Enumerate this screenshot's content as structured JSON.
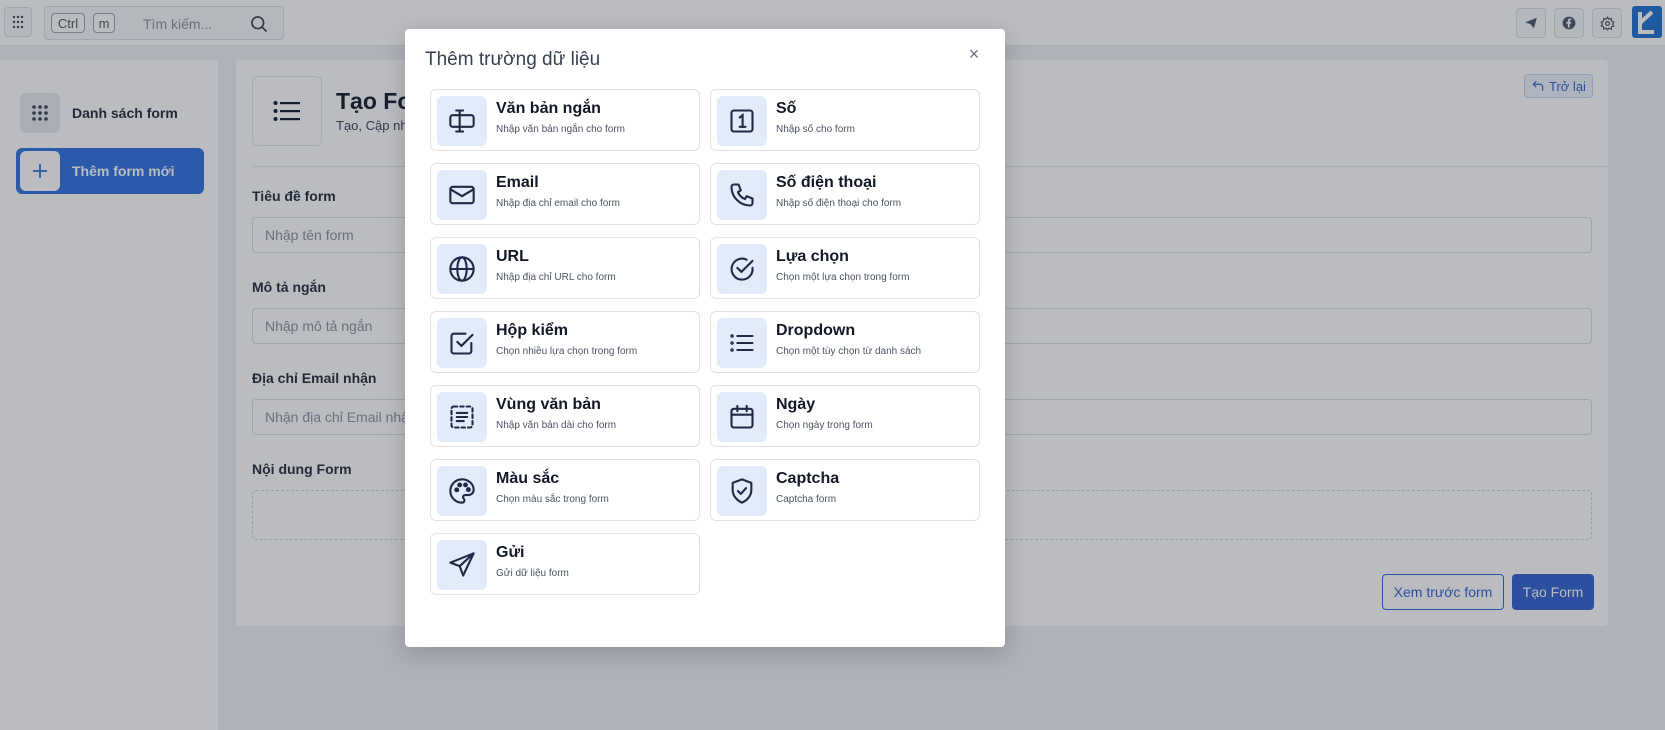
{
  "topbar": {
    "kbd_ctrl": "Ctrl",
    "kbd_m": "m",
    "search_placeholder": "Tìm kiếm..."
  },
  "sidebar": {
    "items": [
      {
        "label": "Danh sách form",
        "icon": "grid-icon"
      },
      {
        "label": "Thêm form mới",
        "icon": "plus-icon"
      }
    ]
  },
  "page": {
    "title": "Tạo Fo",
    "subtitle": "Tạo, Cập nh",
    "back_label": "Trở lại",
    "fields": [
      {
        "label": "Tiêu đề form",
        "placeholder": "Nhập tên form"
      },
      {
        "label": "Mô tả ngắn",
        "placeholder": "Nhập mô tả ngắn"
      },
      {
        "label": "Địa chỉ Email nhận",
        "placeholder": "Nhận địa chỉ Email nhậ"
      }
    ],
    "content_label": "Nội dung Form",
    "preview_button": "Xem trước form",
    "create_button": "Tạo Form"
  },
  "modal": {
    "title": "Thêm trường dữ liệu",
    "close": "×",
    "options": [
      {
        "title": "Văn bản ngắn",
        "desc": "Nhập văn bản ngắn cho form",
        "icon": "text-cursor-icon"
      },
      {
        "title": "Số",
        "desc": "Nhập số cho form",
        "icon": "number-icon"
      },
      {
        "title": "Email",
        "desc": "Nhập địa chỉ email cho form",
        "icon": "mail-icon"
      },
      {
        "title": "Số điện thoại",
        "desc": "Nhập số điện thoại cho form",
        "icon": "phone-icon"
      },
      {
        "title": "URL",
        "desc": "Nhập địa chỉ URL cho form",
        "icon": "globe-icon"
      },
      {
        "title": "Lựa chọn",
        "desc": "Chọn một lựa chọn trong form",
        "icon": "circle-check-icon"
      },
      {
        "title": "Hộp kiểm",
        "desc": "Chọn nhiều lựa chọn trong form",
        "icon": "checkbox-icon"
      },
      {
        "title": "Dropdown",
        "desc": "Chọn một tùy chọn từ danh sách",
        "icon": "list-icon"
      },
      {
        "title": "Vùng văn bản",
        "desc": "Nhập văn bản dài cho form",
        "icon": "textarea-icon"
      },
      {
        "title": "Ngày",
        "desc": "Chọn ngày trong form",
        "icon": "calendar-icon"
      },
      {
        "title": "Màu sắc",
        "desc": "Chọn màu sắc trong form",
        "icon": "palette-icon"
      },
      {
        "title": "Captcha",
        "desc": "Captcha form",
        "icon": "shield-check-icon"
      },
      {
        "title": "Gửi",
        "desc": "Gửi dữ liệu form",
        "icon": "send-icon"
      }
    ]
  },
  "colors": {
    "accent": "#2f5fd0",
    "sidebar_active": "#2f6fe0",
    "icon_tile": "#e2ebfa",
    "brand": "#1b6fd1"
  }
}
